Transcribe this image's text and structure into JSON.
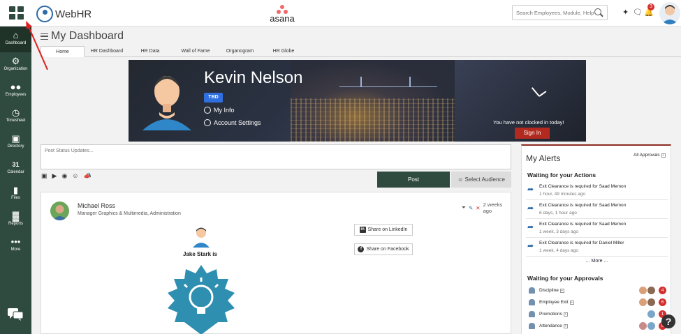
{
  "app": {
    "name": "WebHR",
    "company_logo_text": "asana"
  },
  "header": {
    "search_placeholder": "Search Employees, Module, Help...",
    "notification_count": "3"
  },
  "sidebar": {
    "items": [
      {
        "label": "Dashboard",
        "icon": "home-icon"
      },
      {
        "label": "Organization",
        "icon": "gear-icon"
      },
      {
        "label": "Employees",
        "icon": "people-icon"
      },
      {
        "label": "Timesheet",
        "icon": "clock-icon"
      },
      {
        "label": "Directory",
        "icon": "id-card-icon"
      },
      {
        "label": "Calendar",
        "icon": "calendar-icon"
      },
      {
        "label": "Files",
        "icon": "folder-icon"
      },
      {
        "label": "Reports",
        "icon": "bar-chart-icon"
      },
      {
        "label": "More",
        "icon": "ellipsis-icon"
      }
    ],
    "calendar_day": "31"
  },
  "page": {
    "title": "My Dashboard"
  },
  "tabs": [
    "Home",
    "HR Dashboard",
    "HR Data",
    "Wall of Fame",
    "Organogram",
    "HR Globe"
  ],
  "banner": {
    "name": "Kevin Nelson",
    "badge": "TBD",
    "my_info": "My Info",
    "account_settings": "Account Settings",
    "clock_status": "You have not clocked in today!",
    "sign_in": "Sign In"
  },
  "status": {
    "placeholder": "Post Status Updates...",
    "post_label": "Post",
    "audience_label": "Select Audience"
  },
  "feed": {
    "author": "Michael Ross",
    "role": "Manager Graphics & Multimedia, Administration",
    "time": "2 weeks ago",
    "share_linkedin": "Share on LinkedIn",
    "share_facebook": "Share on Facebook",
    "post_text": "Jake Stark is"
  },
  "alerts": {
    "title": "My Alerts",
    "all_approvals": "All Approvals",
    "actions_heading": "Waiting for your Actions",
    "actions": [
      {
        "text": "Exit Clearance is required for Saad Memon",
        "time": "1 hour, 49 minutes ago"
      },
      {
        "text": "Exit Clearance is required for Saad Memon",
        "time": "6 days, 1 hour ago"
      },
      {
        "text": "Exit Clearance is required for Saad Memon",
        "time": "1 week, 3 days ago"
      },
      {
        "text": "Exit Clearance is required for Daniel Miller",
        "time": "1 week, 4 days ago"
      }
    ],
    "more": "... More ...",
    "approvals_heading": "Waiting for your Approvals",
    "approvals": [
      {
        "label": "Discipline",
        "count": "4"
      },
      {
        "label": "Employee Exit",
        "count": "6"
      },
      {
        "label": "Promotions",
        "count": "1"
      },
      {
        "label": "Attendance",
        "count": "5"
      }
    ]
  },
  "colors": {
    "sidebar": "#2f4a3e",
    "accent_red": "#d32f2f",
    "banner_sign_in": "#b22a1f",
    "badge_blue": "#2f6fe0"
  }
}
